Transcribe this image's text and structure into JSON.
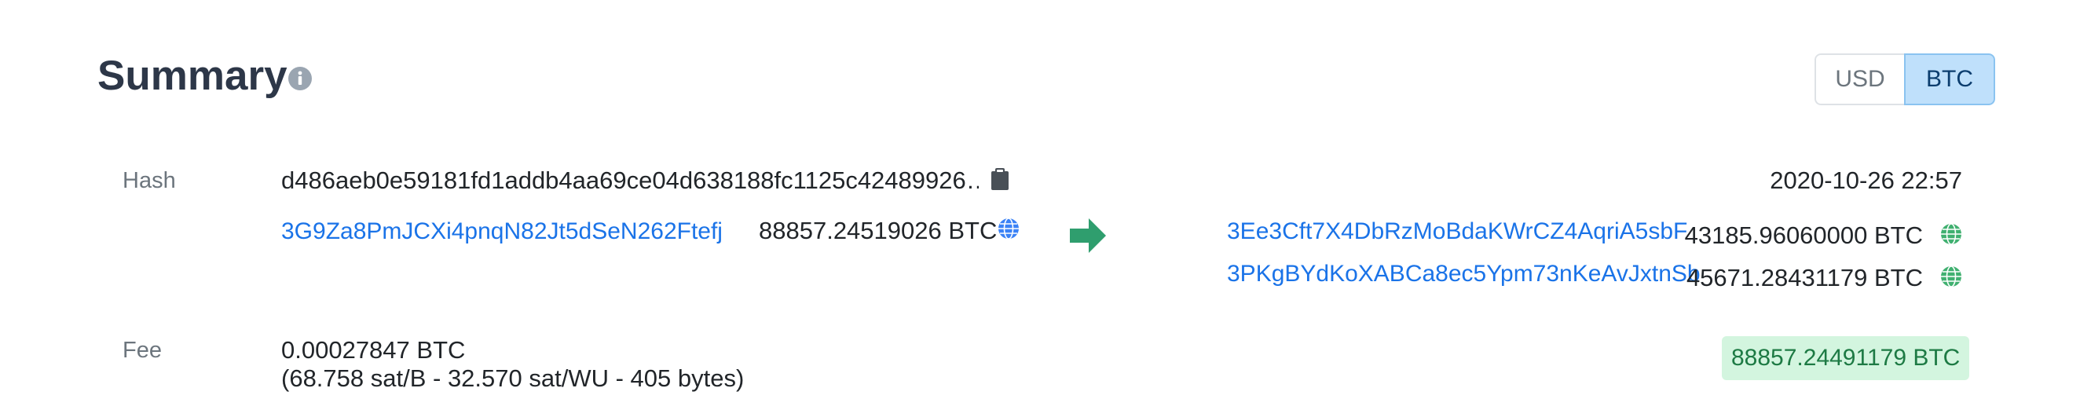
{
  "summary": {
    "title": "Summary",
    "info_icon": "info-circle-icon"
  },
  "currency_toggle": {
    "options": [
      "USD",
      "BTC"
    ],
    "selected": "BTC"
  },
  "hash": {
    "label": "Hash",
    "value": "d486aeb0e59181fd1addb4aa69ce04d638188fc1125c42489926…",
    "copy_icon": "clipboard-icon",
    "timestamp": "2020-10-26 22:57"
  },
  "inputs": [
    {
      "address": "3G9Za8PmJCXi4pnqN82Jt5dSeN262Ftefj",
      "amount": "88857.24519026 BTC",
      "icon": "globe-icon",
      "icon_color": "#3b82f6"
    }
  ],
  "arrow": {
    "icon": "arrow-right-icon",
    "color": "#2f9e6e"
  },
  "outputs": [
    {
      "address": "3Ee3Cft7X4DbRzMoBdaKWrCZ4AqriA5sbF",
      "amount": "43185.96060000 BTC",
      "icon": "globe-icon",
      "icon_color": "#40b070"
    },
    {
      "address": "3PKgBYdKoXABCa8ec5Ypm73nKeAvJxtnSb",
      "amount": "45671.28431179 BTC",
      "icon": "globe-icon",
      "icon_color": "#40b070"
    }
  ],
  "fee": {
    "label": "Fee",
    "value": "0.00027847 BTC",
    "details": "(68.758 sat/B - 32.570 sat/WU - 405 bytes)",
    "total": "88857.24491179 BTC"
  },
  "colors": {
    "link": "#1a73e8",
    "accent_green": "#2f9e6e",
    "badge_bg": "#d3f5df",
    "badge_text": "#1d7a44",
    "toggle_active_bg": "#bfe0fb"
  }
}
